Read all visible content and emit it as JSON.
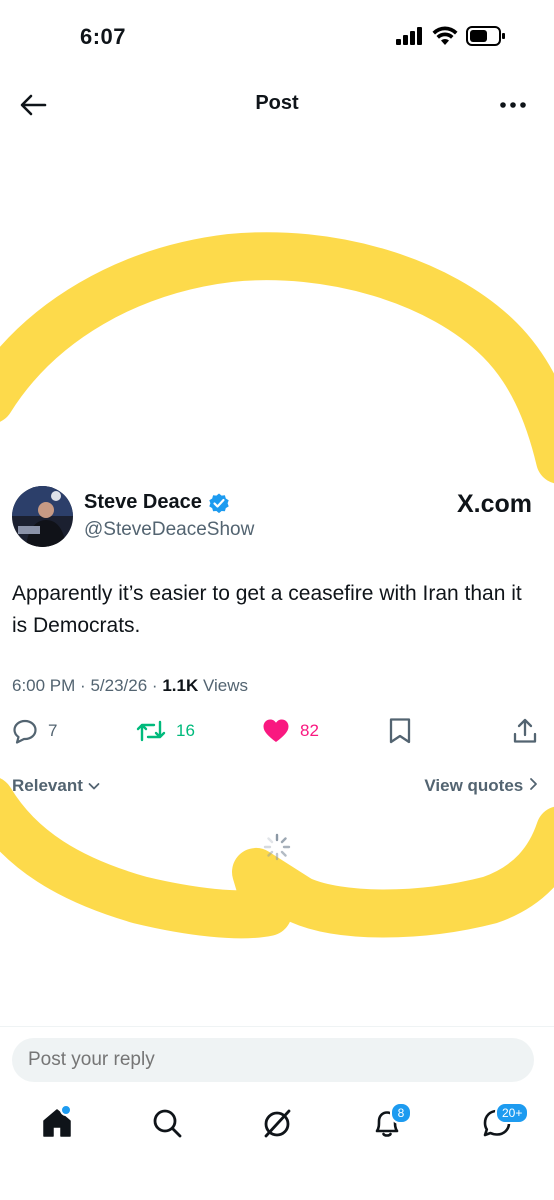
{
  "status_bar": {
    "time": "6:07"
  },
  "header": {
    "title": "Post"
  },
  "tweet": {
    "author_name": "Steve Deace",
    "author_handle": "@SteveDeaceShow",
    "source_logo": "X.com",
    "text": "Apparently it’s easier to get a ceasefire with Iran than it is Democrats.",
    "time": "6:00 PM",
    "date": "5/23/26",
    "views_count": "1.1K",
    "views_label": "Views",
    "replies": "7",
    "retweets": "16",
    "likes": "82"
  },
  "filters": {
    "sort_label": "Relevant",
    "view_quotes_label": "View quotes"
  },
  "reply_box": {
    "placeholder": "Post your reply"
  },
  "nav": {
    "notifications_badge": "8",
    "messages_badge": "20+"
  },
  "colors": {
    "accent": "#1d9bf0",
    "like": "#f91880",
    "retweet": "#00ba7c",
    "highlight": "#fdd73c"
  }
}
